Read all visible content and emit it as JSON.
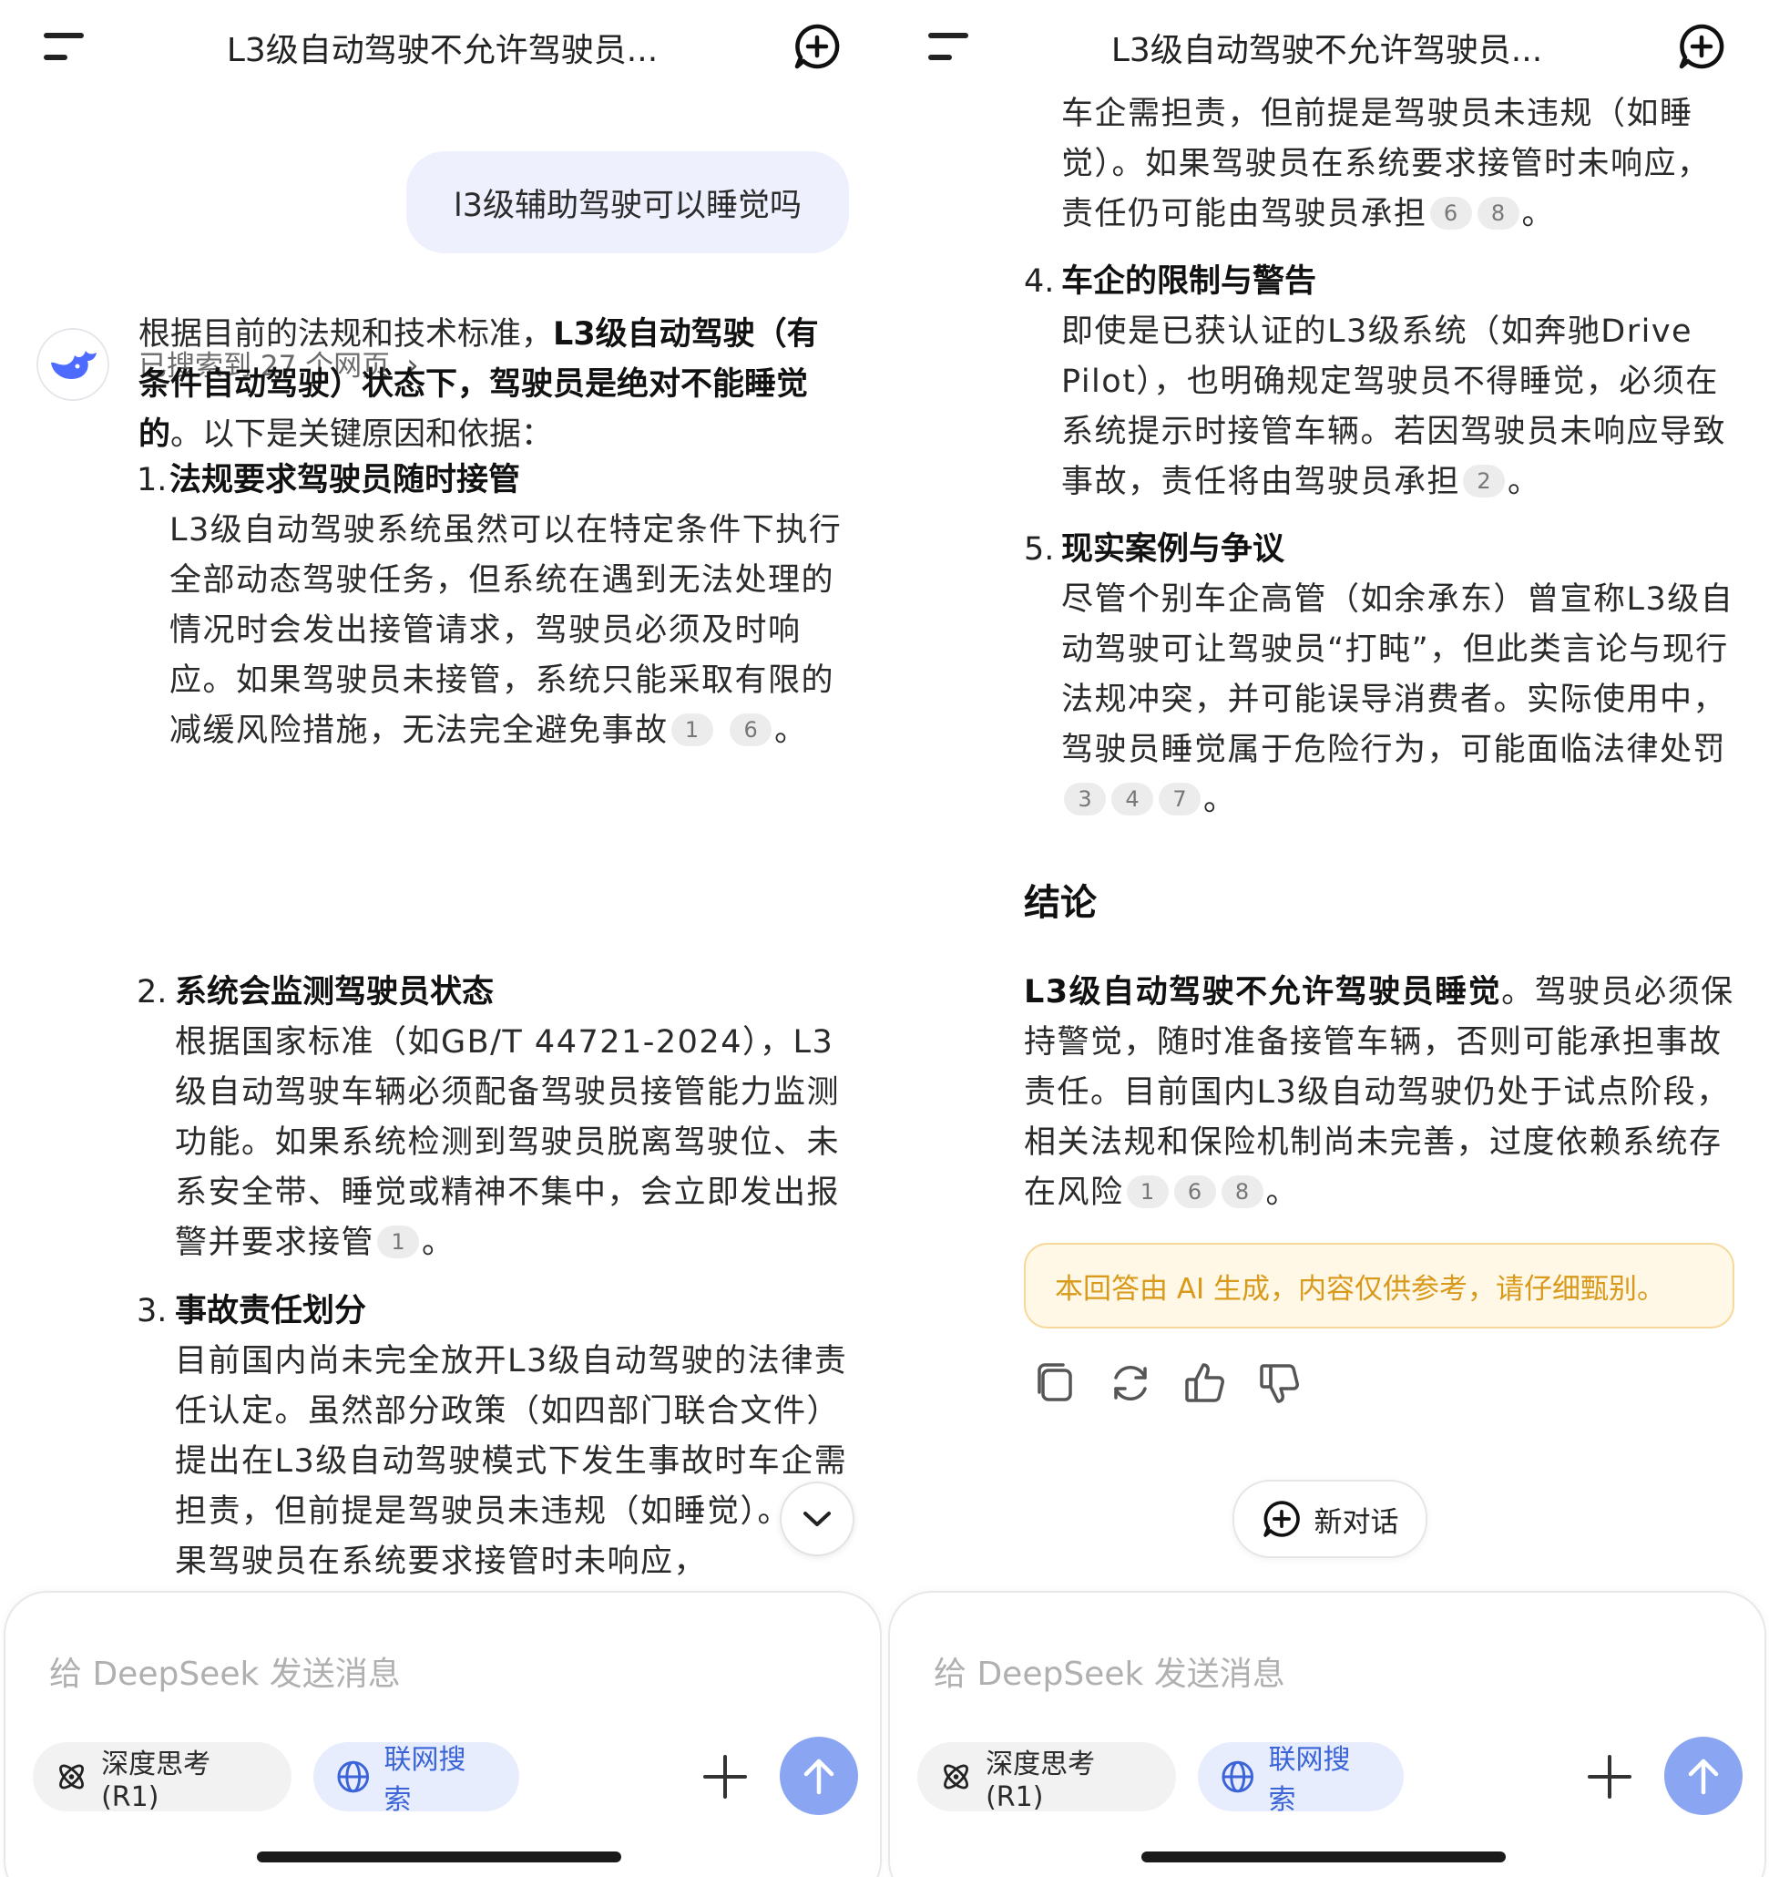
{
  "header": {
    "title": "L3级自动驾驶不允许驾驶员...",
    "menu_icon": "menu-icon",
    "new_chat_icon": "new-chat-icon"
  },
  "user_message": "l3级辅助驾驶可以睡觉吗",
  "search_status": "已搜索到 27 个网页",
  "intro": {
    "p1": "根据目前的法规和技术标准，",
    "bold": "L3级自动驾驶（有条件自动驾驶）状态下，驾驶员是绝对不能睡觉的",
    "p2": "。以下是关键原因和依据："
  },
  "items": [
    {
      "num": "1.",
      "head": "法规要求驾驶员随时接管",
      "body": "L3级自动驾驶系统虽然可以在特定条件下执行全部动态驾驶任务，但系统在遇到无法处理的情况时会发出接管请求，驾驶员必须及时响应。如果驾驶员未接管，系统只能采取有限的减缓风险措施，无法完全避免事故",
      "cites": [
        "1",
        "6"
      ]
    },
    {
      "num": "2.",
      "head": "系统会监测驾驶员状态",
      "body": "根据国家标准（如GB/T 44721-2024），L3级自动驾驶车辆必须配备驾驶员接管能力监测功能。如果系统检测到驾驶员脱离驾驶位、未系安全带、睡觉或精神不集中，会立即发出报警并要求接管",
      "cites": [
        "1"
      ]
    },
    {
      "num": "3.",
      "head": "事故责任划分",
      "body": "目前国内尚未完全放开L3级自动驾驶的法律责任认定。虽然部分政策（如四部门联合文件）提出在L3级自动驾驶模式下发生事故时车企需担责，但前提是驾驶员未违规（如睡觉）。如果驾驶员在系统要求接管时未响应，",
      "body_cont": "车企需担责，但前提是驾驶员未违规（如睡觉）。如果驾驶员在系统要求接管时未响应，责任仍可能由驾驶员承担",
      "cites": [
        "6",
        "8"
      ]
    },
    {
      "num": "4.",
      "head": "车企的限制与警告",
      "body": "即使是已获认证的L3级系统（如奔驰Drive Pilot），也明确规定驾驶员不得睡觉，必须在系统提示时接管车辆。若因驾驶员未响应导致事故，责任将由驾驶员承担",
      "cites": [
        "2"
      ]
    },
    {
      "num": "5.",
      "head": "现实案例与争议",
      "body": "尽管个别车企高管（如余承东）曾宣称L3级自动驾驶可让驾驶员“打盹”，但此类言论与现行法规冲突，并可能误导消费者。实际使用中，驾驶员睡觉属于危险行为，可能面临法律处罚",
      "cites": [
        "3",
        "4",
        "7"
      ]
    }
  ],
  "conclusion": {
    "heading": "结论",
    "bold": "L3级自动驾驶不允许驾驶员睡觉",
    "body": "。驾驶员必须保持警觉，随时准备接管车辆，否则可能承担事故责任。目前国内L3级自动驾驶仍处于试点阶段，相关法规和保险机制尚未完善，过度依赖系统存在风险",
    "cites": [
      "1",
      "6",
      "8"
    ]
  },
  "disclaimer": "本回答由 AI 生成，内容仅供参考，请仔细甄别。",
  "new_chat_label": "新对话",
  "composer": {
    "placeholder": "给 DeepSeek 发送消息",
    "deep_think_label": "深度思考 (R1)",
    "web_search_label": "联网搜索"
  },
  "colors": {
    "accent": "#4d6bfe",
    "send": "#8aa6f3",
    "web_chip_bg": "#e7edfd",
    "user_bubble": "#eef1fd",
    "warning": "#d99a1c"
  },
  "punct": {
    "period": "。"
  }
}
